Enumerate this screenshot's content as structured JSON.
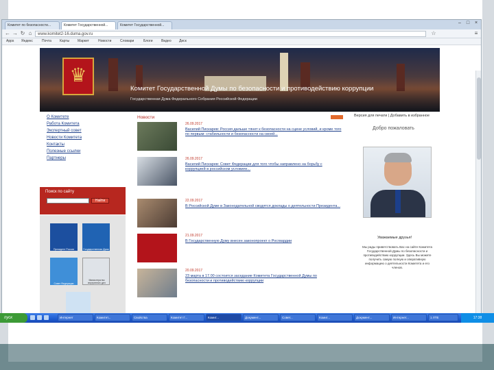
{
  "browser": {
    "tabs": [
      {
        "label": "Комитет по безопасности..."
      },
      {
        "label": "Комитет Государственной..."
      },
      {
        "label": "Комитет Государственной..."
      }
    ],
    "address": "www.komitet2-16.duma.gov.ru",
    "bookmarks": [
      "Apps",
      "Яндекс",
      "Почта",
      "Карты",
      "Маркет",
      "Новости",
      "Словари",
      "Блоги",
      "Видео",
      "Диск"
    ]
  },
  "site": {
    "title": "Комитет Государственной Думы по безопасности и противодействию коррупции",
    "subtitle": "Государственная Дума Федерального Собрания Российской Федерации",
    "menu": [
      "О Комитете",
      "Работа Комитета",
      "Экспертный совет",
      "Новости Комитета",
      "Контакты",
      "Полезные ссылки",
      "Партнеры"
    ],
    "search": {
      "label": "Поиск по сайту",
      "button": "Найти"
    },
    "banners": [
      "Президент России",
      "Государственная Дума",
      "Совет Федерации",
      "Министерство внутренних дел"
    ],
    "news_heading": "Новости",
    "news": [
      {
        "date": "26.09.2017",
        "text": "Василий Пискарев: Россия дальше тянет к безопасности на сцене условий, и кроме того по первым: стабильности и безопасности на своей..."
      },
      {
        "date": "26.09.2017",
        "text": "Василий Пискарев: Совет Федерации для того чтобы направлено на борьбу с коррупцией в российском условиях..."
      },
      {
        "date": "22.09.2017",
        "text": "В Российской Думе в Законодательной сводятся доклады о деятельности Президента..."
      },
      {
        "date": "21.09.2017",
        "text": "В Государственную Думу внесен законопроект о Росгвардии"
      },
      {
        "date": "20.09.2017",
        "text": "23 марта в 17.00 состоится заседание Комитета Государственной Думы по безопасности и противодействию коррупции"
      }
    ],
    "utility": "Версия для печати | Добавить в избранное",
    "welcome": "Добро пожаловать",
    "greeting": "Уважаемые друзья!",
    "letter": "Мы рады приветствовать Вас на сайте Комитета Государственной Думы по безопасности и противодействию коррупции. Здесь Вы можете получить самую полную и оперативную информацию о деятельности Комитета и его членов."
  },
  "taskbar": {
    "start": "пуск",
    "tasks": [
      "Интернет",
      "Комитет...",
      "Свойства",
      "Комитет Г...",
      "Комит...",
      "Документ...",
      "Совет...",
      "Комит...",
      "Документ...",
      "Интернет...",
      "1 ЛТЕ"
    ],
    "clock": "17:38"
  }
}
